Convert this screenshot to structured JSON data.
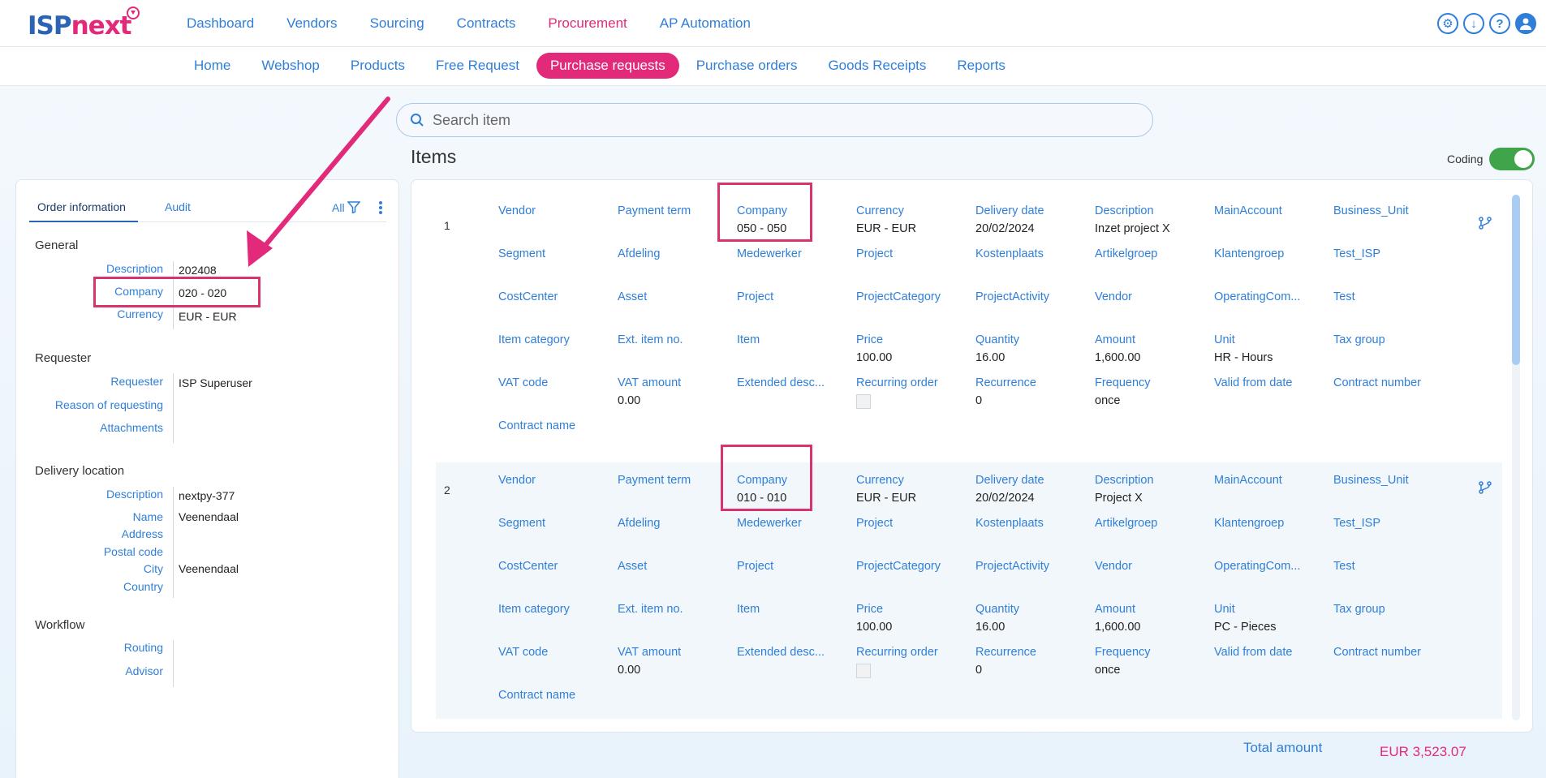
{
  "logo": {
    "part1": "ISP",
    "part2": "next"
  },
  "main_nav": [
    "Dashboard",
    "Vendors",
    "Sourcing",
    "Contracts",
    "Procurement",
    "AP Automation"
  ],
  "main_nav_active": "Procurement",
  "top_icons": [
    "gear-icon",
    "download-icon",
    "help-icon",
    "user-icon"
  ],
  "sub_nav": [
    "Home",
    "Webshop",
    "Products",
    "Free Request",
    "Purchase requests",
    "Purchase orders",
    "Goods Receipts",
    "Reports"
  ],
  "sub_nav_active": "Purchase requests",
  "search": {
    "placeholder": "Search item",
    "value": ""
  },
  "items_title": "Items",
  "coding": {
    "label": "Coding",
    "on": true
  },
  "left": {
    "tabs": [
      "Order information",
      "Audit"
    ],
    "filter_label": "All",
    "general": {
      "title": "General",
      "rows": [
        {
          "label": "Description",
          "value": "202408"
        },
        {
          "label": "Company",
          "value": "020 - 020"
        },
        {
          "label": "Currency",
          "value": "EUR - EUR"
        }
      ]
    },
    "requester": {
      "title": "Requester",
      "rows": [
        {
          "label": "Requester",
          "value": "ISP Superuser"
        },
        {
          "label": "Reason of requesting",
          "value": ""
        },
        {
          "label": "Attachments",
          "value": ""
        }
      ]
    },
    "delivery": {
      "title": "Delivery location",
      "rows": [
        {
          "label": "Description",
          "value": "nextpy-377"
        },
        {
          "label": "Name",
          "value": "Veenendaal"
        },
        {
          "label": "Address",
          "value": ""
        },
        {
          "label": "Postal code",
          "value": ""
        },
        {
          "label": "City",
          "value": "Veenendaal"
        },
        {
          "label": "Country",
          "value": ""
        }
      ]
    },
    "workflow": {
      "title": "Workflow",
      "rows": [
        {
          "label": "Routing",
          "value": ""
        },
        {
          "label": "Advisor",
          "value": ""
        }
      ]
    }
  },
  "items": [
    {
      "number": "1",
      "rows": [
        [
          {
            "label": "Vendor",
            "value": ""
          },
          {
            "label": "Payment term",
            "value": ""
          },
          {
            "label": "Company",
            "value": "050 - 050"
          },
          {
            "label": "Currency",
            "value": "EUR - EUR"
          },
          {
            "label": "Delivery date",
            "value": "20/02/2024"
          },
          {
            "label": "Description",
            "value": "Inzet project X"
          },
          {
            "label": "MainAccount",
            "value": ""
          },
          {
            "label": "Business_Unit",
            "value": ""
          }
        ],
        [
          {
            "label": "Segment",
            "value": ""
          },
          {
            "label": "Afdeling",
            "value": ""
          },
          {
            "label": "Medewerker",
            "value": ""
          },
          {
            "label": "Project",
            "value": ""
          },
          {
            "label": "Kostenplaats",
            "value": ""
          },
          {
            "label": "Artikelgroep",
            "value": ""
          },
          {
            "label": "Klantengroep",
            "value": ""
          },
          {
            "label": "Test_ISP",
            "value": ""
          }
        ],
        [
          {
            "label": "CostCenter",
            "value": ""
          },
          {
            "label": "Asset",
            "value": ""
          },
          {
            "label": "Project",
            "value": ""
          },
          {
            "label": "ProjectCategory",
            "value": ""
          },
          {
            "label": "ProjectActivity",
            "value": ""
          },
          {
            "label": "Vendor",
            "value": ""
          },
          {
            "label": "OperatingCom...",
            "value": ""
          },
          {
            "label": "Test",
            "value": ""
          }
        ],
        [
          {
            "label": "Item category",
            "value": ""
          },
          {
            "label": "Ext. item no.",
            "value": ""
          },
          {
            "label": "Item",
            "value": ""
          },
          {
            "label": "Price",
            "value": "100.00"
          },
          {
            "label": "Quantity",
            "value": "16.00"
          },
          {
            "label": "Amount",
            "value": "1,600.00"
          },
          {
            "label": "Unit",
            "value": "HR - Hours"
          },
          {
            "label": "Tax group",
            "value": ""
          }
        ],
        [
          {
            "label": "VAT code",
            "value": ""
          },
          {
            "label": "VAT amount",
            "value": "0.00"
          },
          {
            "label": "Extended desc...",
            "value": ""
          },
          {
            "label": "Recurring order",
            "value": "",
            "checkbox": true
          },
          {
            "label": "Recurrence",
            "value": "0"
          },
          {
            "label": "Frequency",
            "value": "once"
          },
          {
            "label": "Valid from date",
            "value": ""
          },
          {
            "label": "Contract number",
            "value": ""
          }
        ],
        [
          {
            "label": "Contract name",
            "value": ""
          }
        ]
      ]
    },
    {
      "number": "2",
      "rows": [
        [
          {
            "label": "Vendor",
            "value": ""
          },
          {
            "label": "Payment term",
            "value": ""
          },
          {
            "label": "Company",
            "value": "010 - 010"
          },
          {
            "label": "Currency",
            "value": "EUR - EUR"
          },
          {
            "label": "Delivery date",
            "value": "20/02/2024"
          },
          {
            "label": "Description",
            "value": "Project X"
          },
          {
            "label": "MainAccount",
            "value": ""
          },
          {
            "label": "Business_Unit",
            "value": ""
          }
        ],
        [
          {
            "label": "Segment",
            "value": ""
          },
          {
            "label": "Afdeling",
            "value": ""
          },
          {
            "label": "Medewerker",
            "value": ""
          },
          {
            "label": "Project",
            "value": ""
          },
          {
            "label": "Kostenplaats",
            "value": ""
          },
          {
            "label": "Artikelgroep",
            "value": ""
          },
          {
            "label": "Klantengroep",
            "value": ""
          },
          {
            "label": "Test_ISP",
            "value": ""
          }
        ],
        [
          {
            "label": "CostCenter",
            "value": ""
          },
          {
            "label": "Asset",
            "value": ""
          },
          {
            "label": "Project",
            "value": ""
          },
          {
            "label": "ProjectCategory",
            "value": ""
          },
          {
            "label": "ProjectActivity",
            "value": ""
          },
          {
            "label": "Vendor",
            "value": ""
          },
          {
            "label": "OperatingCom...",
            "value": ""
          },
          {
            "label": "Test",
            "value": ""
          }
        ],
        [
          {
            "label": "Item category",
            "value": ""
          },
          {
            "label": "Ext. item no.",
            "value": ""
          },
          {
            "label": "Item",
            "value": ""
          },
          {
            "label": "Price",
            "value": "100.00"
          },
          {
            "label": "Quantity",
            "value": "16.00"
          },
          {
            "label": "Amount",
            "value": "1,600.00"
          },
          {
            "label": "Unit",
            "value": "PC - Pieces"
          },
          {
            "label": "Tax group",
            "value": ""
          }
        ],
        [
          {
            "label": "VAT code",
            "value": ""
          },
          {
            "label": "VAT amount",
            "value": "0.00"
          },
          {
            "label": "Extended desc...",
            "value": ""
          },
          {
            "label": "Recurring order",
            "value": "",
            "checkbox": true
          },
          {
            "label": "Recurrence",
            "value": "0"
          },
          {
            "label": "Frequency",
            "value": "once"
          },
          {
            "label": "Valid from date",
            "value": ""
          },
          {
            "label": "Contract number",
            "value": ""
          }
        ],
        [
          {
            "label": "Contract name",
            "value": ""
          }
        ]
      ]
    }
  ],
  "total": {
    "label": "Total amount",
    "value": "EUR 3,523.07"
  },
  "colors": {
    "accent": "#2f7fd8",
    "brand_pink": "#e3297a",
    "highlight": "#d9336f",
    "toggle_on": "#3fa44a"
  }
}
